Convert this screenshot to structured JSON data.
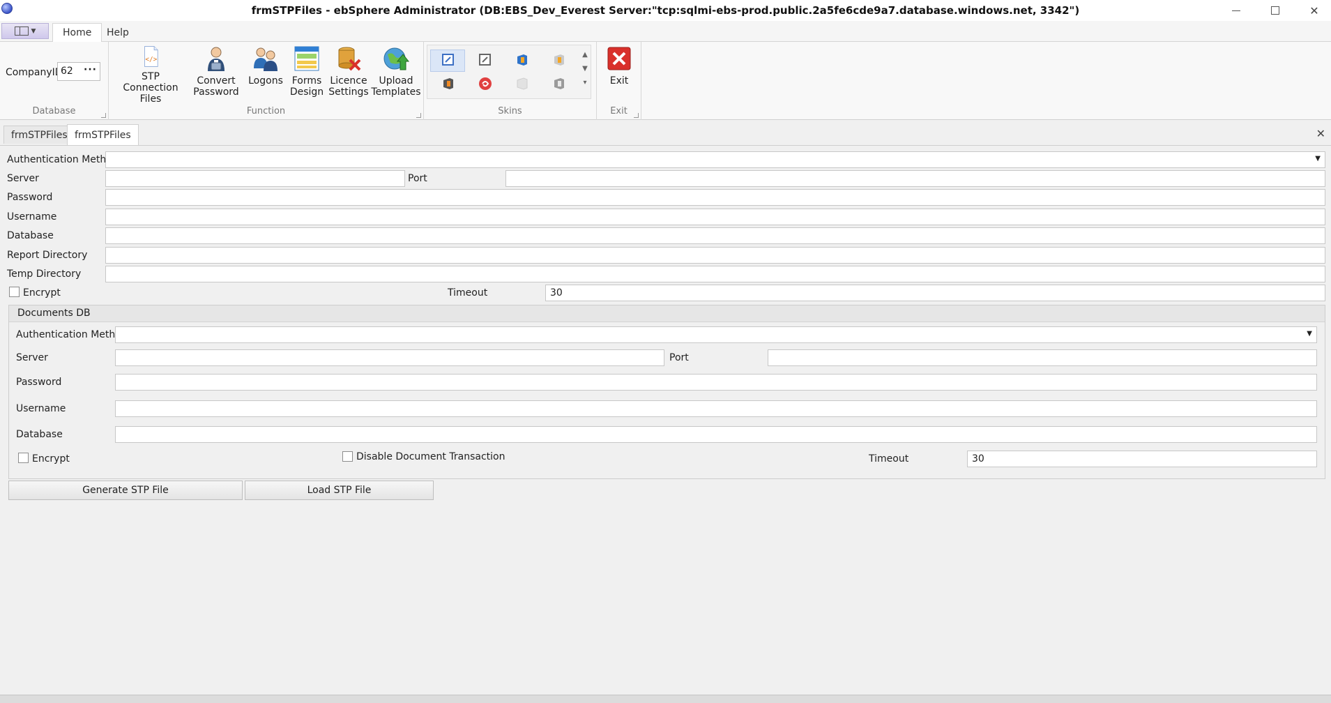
{
  "window": {
    "title": "frmSTPFiles - ebSphere Administrator (DB:EBS_Dev_Everest Server:\"tcp:sqlmi-ebs-prod.public.2a5fe6cde9a7.database.windows.net, 3342\")",
    "minimize_icon": "minimize-icon",
    "maximize_icon": "maximize-icon",
    "close_glyph": "✕"
  },
  "ribbon": {
    "tabs": [
      {
        "label": "Home",
        "active": true
      },
      {
        "label": "Help",
        "active": false
      }
    ],
    "database_group": {
      "company_label": "CompanyID",
      "company_value": "62",
      "ellipsis": "···",
      "label": "Database"
    },
    "function_group": {
      "label": "Function",
      "buttons": [
        {
          "line1": "STP Connection",
          "line2": "Files",
          "icon": "stp-connection-files-icon"
        },
        {
          "line1": "Convert",
          "line2": "Password",
          "icon": "convert-password-icon"
        },
        {
          "line1": "Logons",
          "line2": "",
          "icon": "logons-icon"
        },
        {
          "line1": "Forms",
          "line2": "Design",
          "icon": "forms-design-icon"
        },
        {
          "line1": "Licence",
          "line2": "Settings",
          "icon": "licence-settings-icon"
        },
        {
          "line1": "Upload",
          "line2": "Templates",
          "icon": "upload-templates-icon"
        }
      ]
    },
    "skins_group": {
      "label": "Skins"
    },
    "exit_group": {
      "label": "Exit",
      "button": "Exit"
    }
  },
  "doc_tabs": [
    {
      "label": "frmSTPFiles",
      "active": false
    },
    {
      "label": "frmSTPFiles",
      "active": true
    }
  ],
  "main_form": {
    "auth_method_label": "Authentication Method",
    "auth_method_value": "",
    "server_label": "Server",
    "server_value": "",
    "port_label": "Port",
    "port_value": "",
    "password_label": "Password",
    "password_value": "",
    "username_label": "Username",
    "username_value": "",
    "database_label": "Database",
    "database_value": "",
    "report_dir_label": "Report Directory",
    "report_dir_value": "",
    "temp_dir_label": "Temp Directory",
    "temp_dir_value": "",
    "encrypt_label": "Encrypt",
    "timeout_label": "Timeout",
    "timeout_value": "30"
  },
  "documents_db": {
    "title": "Documents DB",
    "auth_method_label": "Authentication Method",
    "auth_method_value": "",
    "server_label": "Server",
    "server_value": "",
    "port_label": "Port",
    "port_value": "",
    "password_label": "Password",
    "password_value": "",
    "username_label": "Username",
    "username_value": "",
    "database_label": "Database",
    "database_value": "",
    "encrypt_label": "Encrypt",
    "disable_tx_label": "Disable Document Transaction",
    "timeout_label": "Timeout",
    "timeout_value": "30"
  },
  "actions": {
    "generate": "Generate STP File",
    "load": "Load STP File"
  },
  "colors": {
    "exit_red": "#d9302b",
    "skin_active": "#dbe6f7"
  }
}
